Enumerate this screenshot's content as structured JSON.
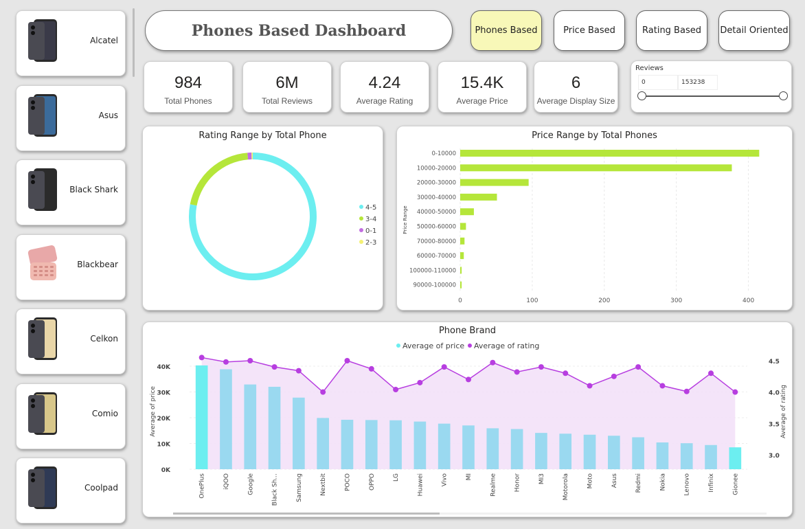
{
  "sidebar": {
    "brands": [
      {
        "label": "Alcatel",
        "icon": "phone-icon",
        "color": "#3a3a48"
      },
      {
        "label": "Asus",
        "icon": "phone-icon",
        "color": "#3b6b9b"
      },
      {
        "label": "Black Shark",
        "icon": "phone-icon",
        "color": "#2b2b2b"
      },
      {
        "label": "Blackbear",
        "icon": "flip-phone-icon",
        "color": "#e8a8a8"
      },
      {
        "label": "Celkon",
        "icon": "phone-icon",
        "color": "#e9d6a8"
      },
      {
        "label": "Comio",
        "icon": "phone-icon",
        "color": "#d8c78a"
      },
      {
        "label": "Coolpad",
        "icon": "phone-icon",
        "color": "#2f3a55"
      }
    ]
  },
  "header": {
    "title": "Phones Based Dashboard",
    "nav": [
      {
        "label": "Phones Based",
        "active": true
      },
      {
        "label": "Price Based",
        "active": false
      },
      {
        "label": "Rating Based",
        "active": false
      },
      {
        "label": "Detail Oriented",
        "active": false
      }
    ]
  },
  "kpis": [
    {
      "value": "984",
      "caption": "Total Phones"
    },
    {
      "value": "6M",
      "caption": "Total Reviews"
    },
    {
      "value": "4.24",
      "caption": "Average Rating"
    },
    {
      "value": "15.4K",
      "caption": "Average Price"
    },
    {
      "value": "6",
      "caption": "Average Display Size"
    }
  ],
  "slicer": {
    "title": "Reviews",
    "min": "0",
    "max": "153238"
  },
  "charts": {
    "donut_title": "Rating Range by Total Phone",
    "bar_title": "Price Range by Total Phones",
    "combo_title": "Phone Brand"
  },
  "chart_data": [
    {
      "type": "pie",
      "title": "Rating Range by Total Phone",
      "categories": [
        "4-5",
        "3-4",
        "0-1",
        "2-3"
      ],
      "values": [
        768,
        203,
        10,
        3
      ],
      "colors": [
        "#6ceef0",
        "#b5e63a",
        "#c26ee0",
        "#f4f074"
      ],
      "legend": "right"
    },
    {
      "type": "bar",
      "title": "Price Range by Total Phones",
      "ylabel": "Price Range",
      "categories": [
        "0-10000",
        "10000-20000",
        "20000-30000",
        "30000-40000",
        "40000-50000",
        "50000-60000",
        "70000-80000",
        "60000-70000",
        "100000-110000",
        "90000-100000"
      ],
      "values": [
        415,
        377,
        95,
        51,
        19,
        8,
        6,
        5,
        2,
        2
      ],
      "xlim": [
        0,
        420
      ],
      "xticks": [
        "0",
        "100",
        "200",
        "300",
        "400"
      ],
      "color": "#b5e63a"
    },
    {
      "type": "bar",
      "title": "Phone Brand",
      "categories": [
        "OnePlus",
        "iQOO",
        "Google",
        "Black Sh...",
        "Samsung",
        "Nextbit",
        "POCO",
        "OPPO",
        "LG",
        "Huawei",
        "Vivo",
        "MI",
        "Realme",
        "Honor",
        "MI3",
        "Motorola",
        "Moto",
        "Asus",
        "Redmi",
        "Nokia",
        "Lenovo",
        "Infinix",
        "Gionee"
      ],
      "series": [
        {
          "name": "Average of price",
          "values": [
            40300,
            38800,
            32900,
            32000,
            27800,
            19900,
            19200,
            19100,
            19000,
            18500,
            17700,
            17000,
            15900,
            15600,
            14100,
            13800,
            13400,
            13000,
            12400,
            10400,
            10100,
            9400,
            8500
          ],
          "color": "#9ad9f0"
        },
        {
          "name": "Average of rating",
          "values": [
            4.55,
            4.48,
            4.5,
            4.4,
            4.34,
            4.0,
            4.5,
            4.37,
            4.04,
            4.15,
            4.4,
            4.2,
            4.47,
            4.32,
            4.4,
            4.3,
            4.1,
            4.25,
            4.4,
            4.1,
            4.01,
            4.3,
            4.0
          ],
          "color": "#b73ee0"
        }
      ],
      "ylabel": "Average of price",
      "y2label": "Average of rating",
      "yticks": [
        "0K",
        "10K",
        "20K",
        "30K",
        "40K"
      ],
      "y2ticks": [
        "3.0",
        "3.5",
        "4.0",
        "4.5"
      ],
      "ylim": [
        0,
        40000
      ],
      "y2lim": [
        2.75,
        4.6
      ],
      "legend": "top-center"
    }
  ]
}
